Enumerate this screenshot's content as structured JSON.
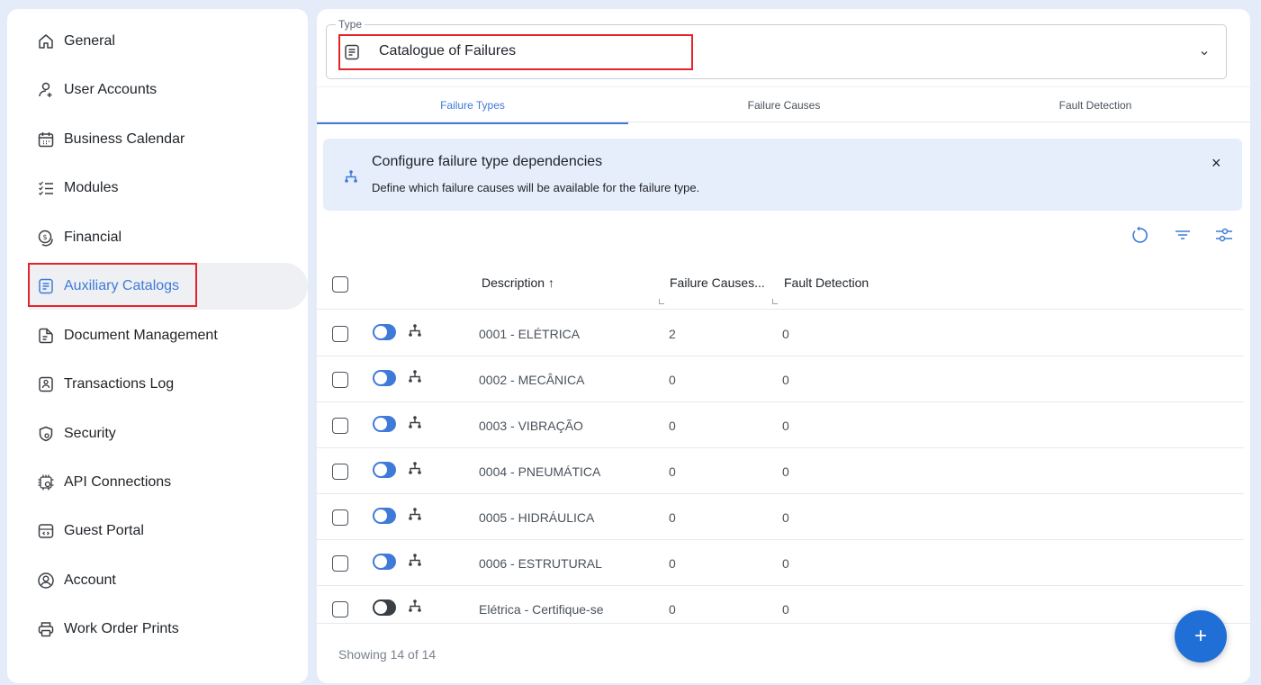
{
  "sidebar": {
    "items": [
      {
        "label": "General",
        "icon": "home-icon"
      },
      {
        "label": "User Accounts",
        "icon": "user-add-icon"
      },
      {
        "label": "Business Calendar",
        "icon": "calendar-icon"
      },
      {
        "label": "Modules",
        "icon": "checklist-icon"
      },
      {
        "label": "Financial",
        "icon": "coin-icon"
      },
      {
        "label": "Auxiliary Catalogs",
        "icon": "catalog-icon"
      },
      {
        "label": "Document Management",
        "icon": "document-icon"
      },
      {
        "label": "Transactions Log",
        "icon": "log-icon"
      },
      {
        "label": "Security",
        "icon": "shield-icon"
      },
      {
        "label": "API Connections",
        "icon": "api-gear-icon"
      },
      {
        "label": "Guest Portal",
        "icon": "portal-icon"
      },
      {
        "label": "Account",
        "icon": "account-icon"
      },
      {
        "label": "Work Order Prints",
        "icon": "printer-icon"
      }
    ],
    "active_index": 5
  },
  "type_select": {
    "legend": "Type",
    "value": "Catalogue of Failures"
  },
  "tabs": [
    {
      "label": "Failure Types",
      "active": true
    },
    {
      "label": "Failure Causes",
      "active": false
    },
    {
      "label": "Fault Detection",
      "active": false
    }
  ],
  "banner": {
    "title": "Configure failure type dependencies",
    "text": "Define which failure causes will be available for the failure type.",
    "close": "×"
  },
  "table": {
    "columns": {
      "description": "Description",
      "sort_arrow": "↑",
      "failure_causes": "Failure Causes...",
      "fault_detection": "Fault Detection"
    },
    "rows": [
      {
        "description": "0001 - ELÉTRICA",
        "failure_causes": "2",
        "fault_detection": "0",
        "enabled": true
      },
      {
        "description": "0002 - MECÂNICA",
        "failure_causes": "0",
        "fault_detection": "0",
        "enabled": true
      },
      {
        "description": "0003 - VIBRAÇÃO",
        "failure_causes": "0",
        "fault_detection": "0",
        "enabled": true
      },
      {
        "description": "0004 - PNEUMÁTICA",
        "failure_causes": "0",
        "fault_detection": "0",
        "enabled": true
      },
      {
        "description": "0005 - HIDRÁULICA",
        "failure_causes": "0",
        "fault_detection": "0",
        "enabled": true
      },
      {
        "description": "0006 - ESTRUTURAL",
        "failure_causes": "0",
        "fault_detection": "0",
        "enabled": true
      },
      {
        "description": "Elétrica - Certifique-se",
        "failure_causes": "0",
        "fault_detection": "0",
        "enabled": false
      }
    ]
  },
  "footer": {
    "showing": "Showing 14 of 14"
  },
  "fab": {
    "label": "+"
  },
  "colors": {
    "accent": "#3f7ad9",
    "highlight": "#e3242b",
    "fab": "#1f6fd6",
    "banner_bg": "#e6eefb",
    "page_bg": "#e3ecf8"
  }
}
